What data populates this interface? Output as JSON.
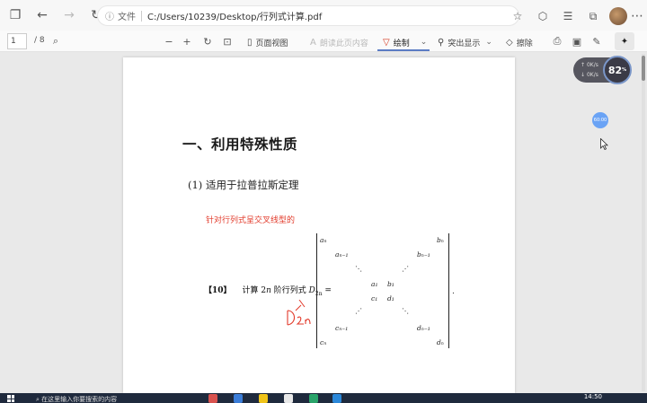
{
  "browser": {
    "addr_label": "文件",
    "url": "C:/Users/10239/Desktop/行列式计算.pdf"
  },
  "pdf_toolbar": {
    "page_current": "1",
    "page_total": "/ 8",
    "page_view": "页面视图",
    "read_aloud": "朗读此页内容",
    "draw": "绘制",
    "highlight": "突出显示",
    "erase": "擦除"
  },
  "document": {
    "heading": "一、利用特殊性质",
    "subheading": "(1)  适用于拉普拉斯定理",
    "note": "针对行列式呈交叉线型的",
    "example_num": "【10】",
    "example_text": "计算 2",
    "example_n": "n",
    "example_text2": " 阶行列式 ",
    "example_D": "D",
    "example_sub": "2n",
    "example_eq": " =",
    "matrix": {
      "a_n": "aₙ",
      "a_n1": "aₙ₋₁",
      "a_1": "a₁",
      "c_1": "c₁",
      "c_n1": "cₙ₋₁",
      "c_n": "cₙ",
      "b_n": "bₙ",
      "b_n1": "bₙ₋₁",
      "b_1": "b₁",
      "d_1": "d₁",
      "d_n1": "dₙ₋₁",
      "d_n": "dₙ",
      "period": "."
    }
  },
  "overlay": {
    "up_speed": "0K/s",
    "down_speed": "0K/s",
    "percent": "82",
    "percent_unit": "%",
    "blue_dot": "60:00"
  },
  "taskbar": {
    "search": "在这里输入你要搜索的内容",
    "time": "14:50"
  },
  "colors": {
    "accent": "#5b7cc4",
    "note_red": "#e23a2a",
    "handwriting_red": "#e23a2a",
    "taskbar": "#1f2a3d"
  }
}
